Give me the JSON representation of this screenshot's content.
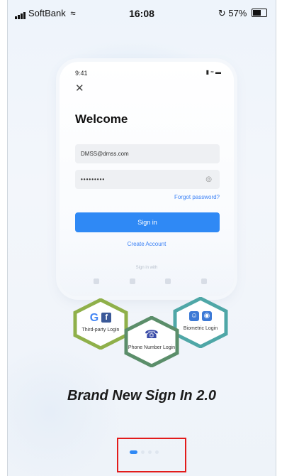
{
  "status_bar": {
    "carrier": "SoftBank",
    "time": "16:08",
    "battery": "57%",
    "wifi_icon": "wifi-icon",
    "battery_icon": "battery-icon"
  },
  "preview_phone": {
    "time": "9:41",
    "status": "▮ ≈ ▬",
    "close": "✕",
    "title": "Welcome",
    "email_value": "DMSS@dmss.com",
    "password_value": "•••••••••",
    "eye": "◎",
    "forgot_password": "Forgot password?",
    "sign_in": "Sign in",
    "create_account": "Create Account",
    "sign_in_with": "Sign in with"
  },
  "features": {
    "third_party": "Third-party Login",
    "google_glyph": "G",
    "facebook_glyph": "f",
    "phone_number": "Phone Number Login",
    "phone_glyph": "☎",
    "biometric": "Biometric Login",
    "face_glyph": "☺",
    "finger_glyph": "◉"
  },
  "tagline": "Brand New Sign In 2.0",
  "pagination": {
    "pages": 4,
    "active_index": 0
  },
  "colors": {
    "accent": "#2f89f5",
    "highlight": "#e21b1b"
  }
}
